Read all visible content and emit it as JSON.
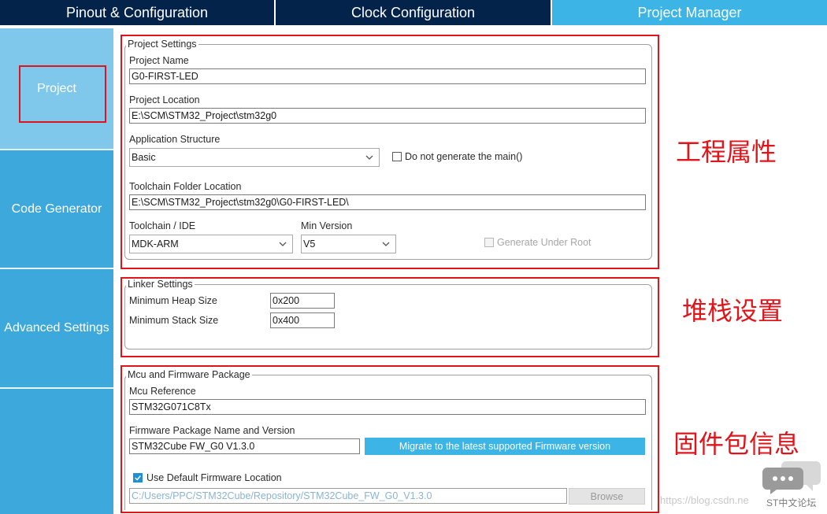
{
  "tabs": [
    {
      "label": "Pinout & Configuration"
    },
    {
      "label": "Clock Configuration"
    },
    {
      "label": "Project Manager"
    }
  ],
  "sidebar": {
    "items": [
      {
        "label": "Project"
      },
      {
        "label": "Code Generator"
      },
      {
        "label": "Advanced Settings"
      }
    ]
  },
  "project_settings": {
    "legend": "Project Settings",
    "project_name_label": "Project Name",
    "project_name_value": "G0-FIRST-LED",
    "project_location_label": "Project Location",
    "project_location_value": "E:\\SCM\\STM32_Project\\stm32g0",
    "app_structure_label": "Application Structure",
    "app_structure_value": "Basic",
    "no_main_label": "Do not generate the main()",
    "toolchain_folder_label": "Toolchain Folder Location",
    "toolchain_folder_value": "E:\\SCM\\STM32_Project\\stm32g0\\G0-FIRST-LED\\",
    "toolchain_ide_label": "Toolchain / IDE",
    "toolchain_ide_value": "MDK-ARM",
    "min_version_label": "Min Version",
    "min_version_value": "V5",
    "generate_under_root_label": "Generate Under Root"
  },
  "linker_settings": {
    "legend": "Linker Settings",
    "heap_label": "Minimum Heap Size",
    "heap_value": "0x200",
    "stack_label": "Minimum Stack Size",
    "stack_value": "0x400"
  },
  "mcu_firmware": {
    "legend": "Mcu and Firmware Package",
    "mcu_ref_label": "Mcu Reference",
    "mcu_ref_value": "STM32G071C8Tx",
    "fw_name_label": "Firmware Package Name and Version",
    "fw_name_value": "STM32Cube FW_G0 V1.3.0",
    "migrate_button": "Migrate to the latest supported Firmware version",
    "use_default_label": "Use Default Firmware Location",
    "fw_path_value": "C:/Users/PPC/STM32Cube/Repository/STM32Cube_FW_G0_V1.3.0",
    "browse_button": "Browse"
  },
  "annotations": {
    "project_props": "工程属性",
    "stack_settings": "堆栈设置",
    "firmware_info": "固件包信息"
  },
  "watermark": {
    "url": "https://blog.csdn.ne",
    "logo_text": "ST中文论坛"
  },
  "colors": {
    "tab_dark": "#03234b",
    "tab_active": "#3cb4e6",
    "sidebar": "#3ca8dc",
    "sidebar_selected": "#7fc8ec",
    "annotation_red": "#e0151b"
  }
}
